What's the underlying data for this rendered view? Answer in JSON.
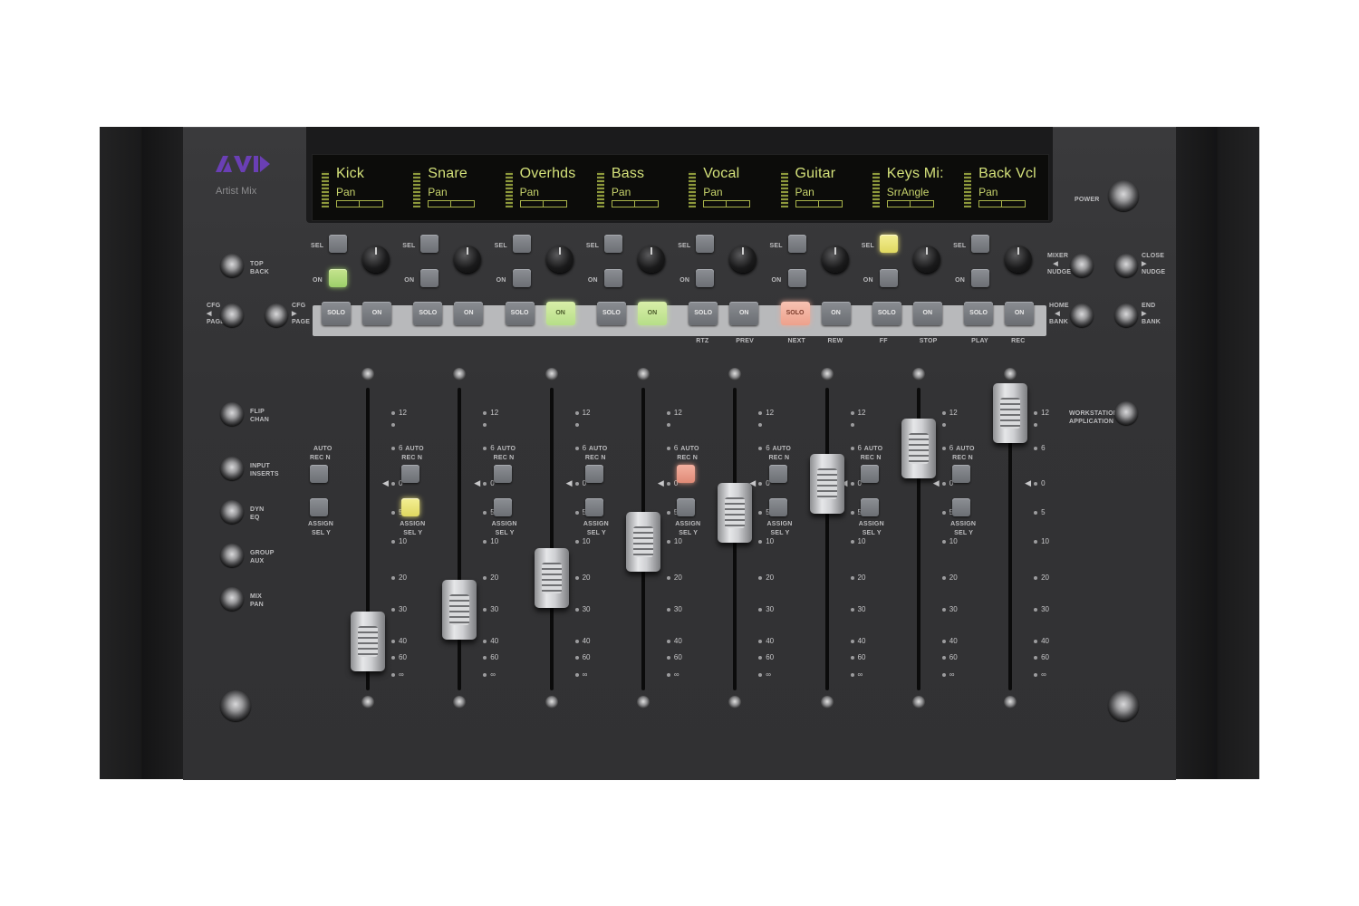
{
  "brand": {
    "logo": "AVID",
    "model": "Artist Mix"
  },
  "colors": {
    "display_text": "#d4e17a",
    "lit_green": "#9ccf6a",
    "lit_yellow": "#e6dc70",
    "lit_red": "#e99a86",
    "logo_purple": "#6a3fb5"
  },
  "channels": [
    {
      "name": "Kick",
      "param": "Pan",
      "sel_lit": "",
      "on_lit": "green",
      "solo_lit": false,
      "on_btn_lit": false,
      "rec_lit": false,
      "assign_lit": false,
      "fader_db": -40,
      "nav_label": ""
    },
    {
      "name": "Snare",
      "param": "Pan",
      "sel_lit": "",
      "on_lit": "",
      "solo_lit": false,
      "on_btn_lit": false,
      "rec_lit": false,
      "assign_lit": true,
      "fader_db": -30,
      "nav_label": ""
    },
    {
      "name": "Overhds",
      "param": "Pan",
      "sel_lit": "",
      "on_lit": "",
      "solo_lit": false,
      "on_btn_lit": true,
      "rec_lit": false,
      "assign_lit": false,
      "fader_db": -20,
      "nav_label": ""
    },
    {
      "name": "Bass",
      "param": "Pan",
      "sel_lit": "",
      "on_lit": "",
      "solo_lit": false,
      "on_btn_lit": true,
      "rec_lit": false,
      "assign_lit": false,
      "fader_db": -10,
      "nav_label": ""
    },
    {
      "name": "Vocal",
      "param": "Pan",
      "sel_lit": "",
      "on_lit": "",
      "solo_lit": false,
      "on_btn_lit": false,
      "rec_lit": true,
      "assign_lit": false,
      "fader_db": -5,
      "nav_label_solo": "RTZ",
      "nav_label_on": "PREV"
    },
    {
      "name": "Guitar",
      "param": "Pan",
      "sel_lit": "",
      "on_lit": "",
      "solo_lit": true,
      "on_btn_lit": false,
      "rec_lit": false,
      "assign_lit": false,
      "fader_db": 0,
      "nav_label_solo": "NEXT",
      "nav_label_on": "REW"
    },
    {
      "name": "Keys Mi:",
      "param": "SrrAngle",
      "sel_lit": "yellow",
      "on_lit": "",
      "solo_lit": false,
      "on_btn_lit": false,
      "rec_lit": false,
      "assign_lit": false,
      "fader_db": 6,
      "nav_label_solo": "FF",
      "nav_label_on": "STOP"
    },
    {
      "name": "Back Vcl",
      "param": "Pan",
      "sel_lit": "",
      "on_lit": "",
      "solo_lit": false,
      "on_btn_lit": false,
      "rec_lit": false,
      "assign_lit": false,
      "fader_db": 12,
      "nav_label_solo": "PLAY",
      "nav_label_on": "REC"
    }
  ],
  "labels": {
    "sel": "SEL",
    "on": "ON",
    "solo": "SOLO",
    "on_btn": "ON",
    "auto": "AUTO",
    "rec_n": "REC N",
    "assign": "ASSIGN",
    "sel_y": "SEL Y"
  },
  "left_buttons": {
    "top_back": [
      "TOP",
      "BACK"
    ],
    "cfg_page_1": [
      "CFG",
      "PAGE"
    ],
    "cfg_page_2": [
      "CFG",
      "PAGE"
    ],
    "flip_chan": [
      "FLIP",
      "CHAN"
    ],
    "input_inserts": [
      "INPUT",
      "INSERTS"
    ],
    "dyn_eq": [
      "DYN",
      "EQ"
    ],
    "group_aux": [
      "GROUP",
      "AUX"
    ],
    "mix_pan": [
      "MIX",
      "PAN"
    ]
  },
  "right_buttons": {
    "power": "POWER",
    "mixer_nudge": [
      "MIXER",
      "NUDGE"
    ],
    "close_nudge": [
      "CLOSE",
      "NUDGE"
    ],
    "home_bank": [
      "HOME",
      "BANK"
    ],
    "end_bank": [
      "END",
      "BANK"
    ],
    "workstation_application": [
      "WORKSTATION",
      "APPLICATION"
    ]
  },
  "fader_scale": [
    "12",
    "6",
    "0",
    "5",
    "10",
    "20",
    "30",
    "40",
    "60",
    "∞"
  ]
}
